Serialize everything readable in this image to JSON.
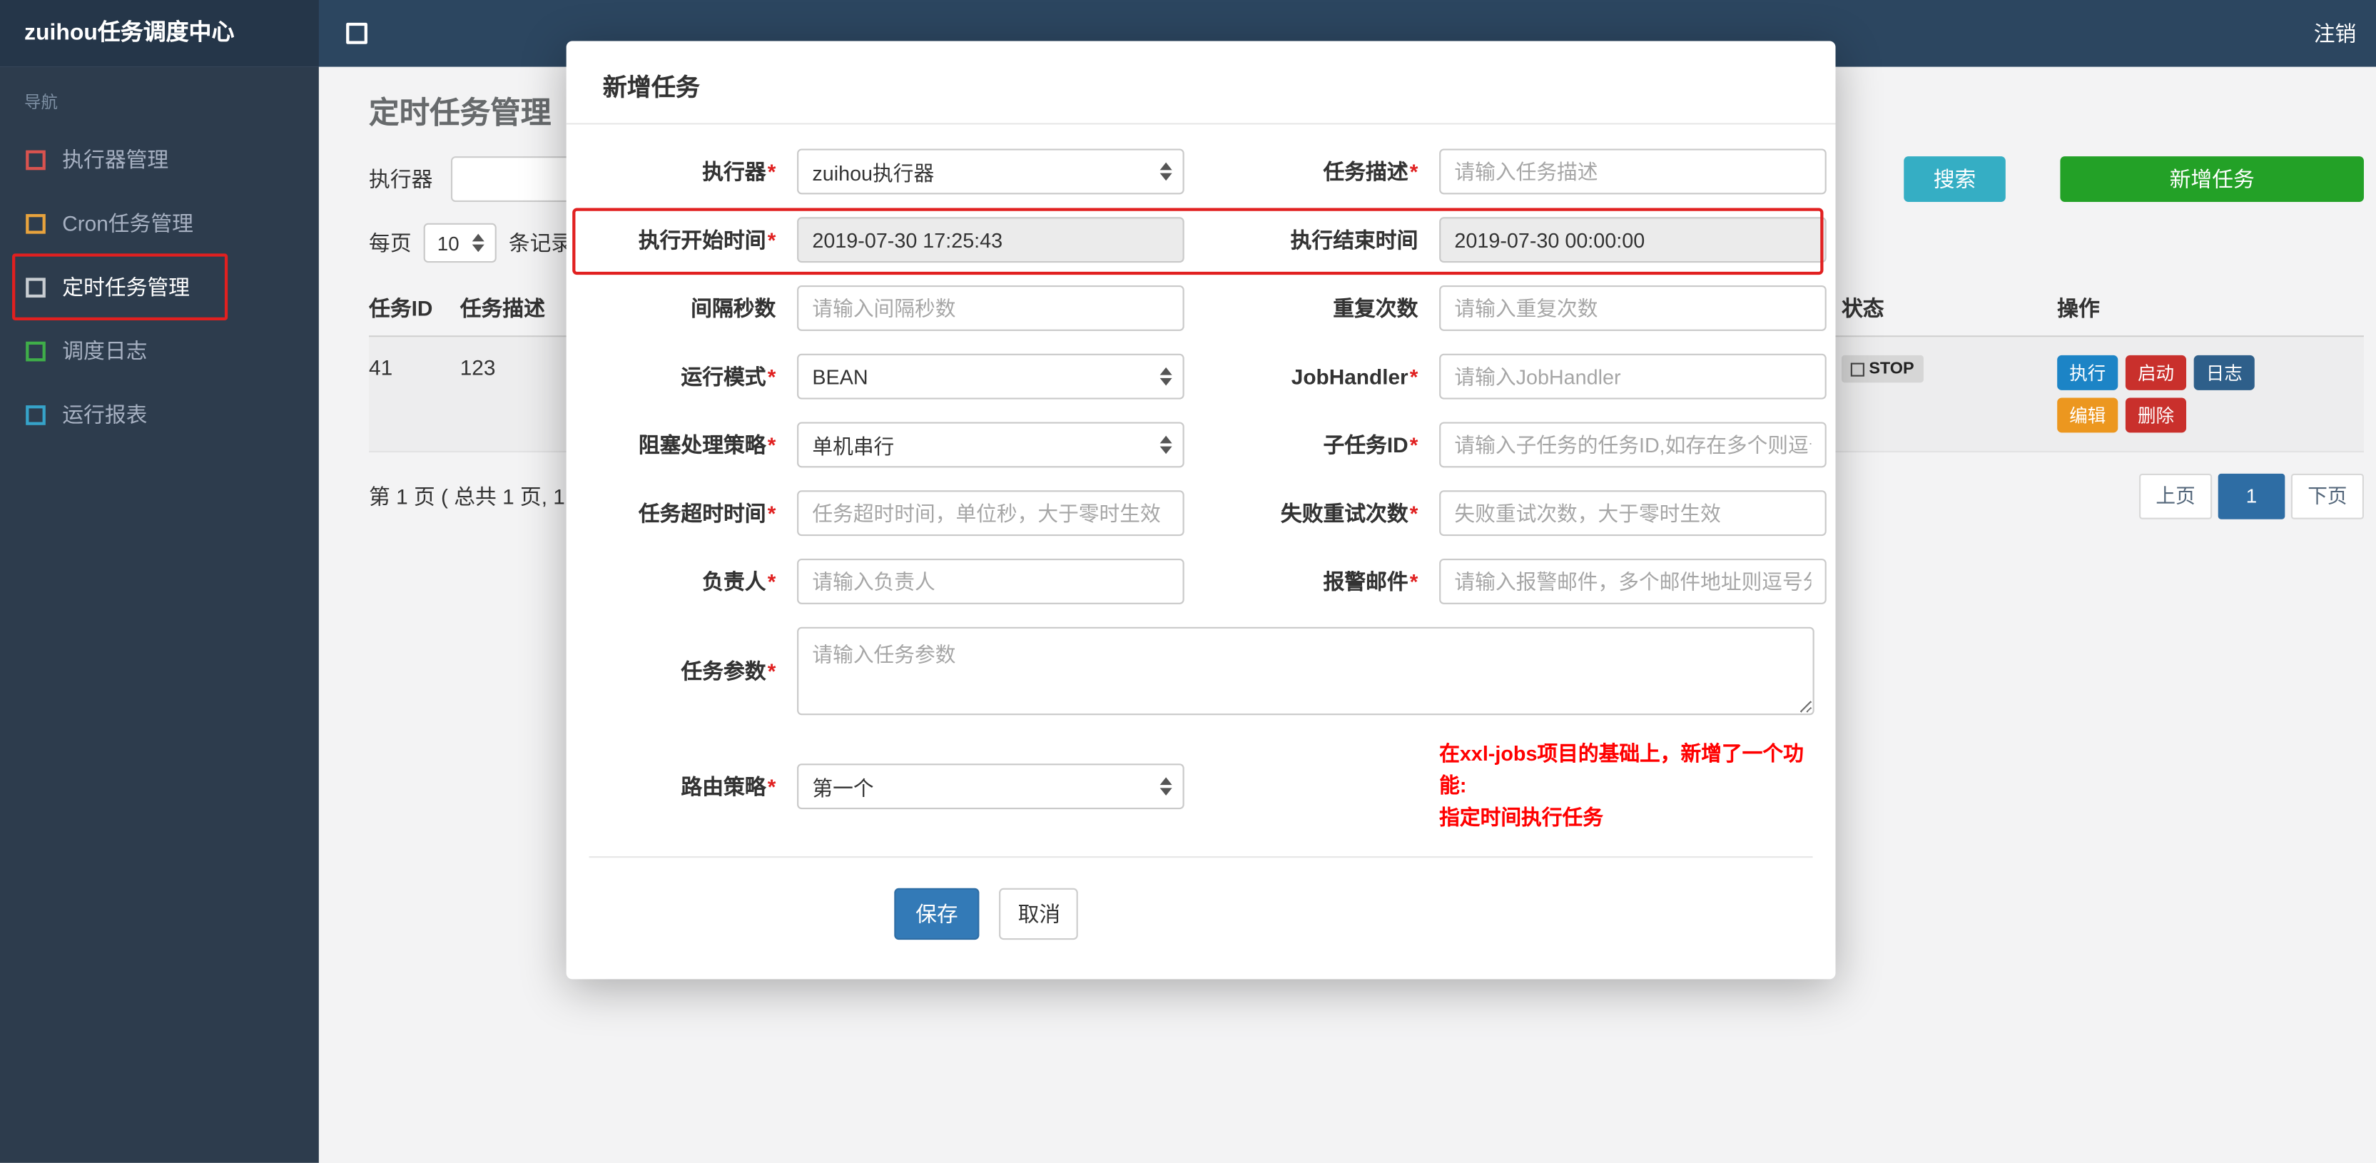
{
  "colors": {
    "topbar": "#2c4660",
    "brand_bg": "#253649",
    "sidebar_bg": "#2d3c4d",
    "search_button": "#35aec4",
    "add_button": "#23a127",
    "save_button": "#337ab7",
    "annotation_red": "#e12020"
  },
  "topbar": {
    "brand": "zuihou任务调度中心",
    "logout": "注销"
  },
  "sidebar": {
    "nav_label": "导航",
    "items": [
      {
        "label": "执行器管理",
        "icon_color": "#d9534f"
      },
      {
        "label": "Cron任务管理",
        "icon_color": "#e8a33d"
      },
      {
        "label": "定时任务管理",
        "icon_color": "#c8cdd2"
      },
      {
        "label": "调度日志",
        "icon_color": "#3fae49"
      },
      {
        "label": "运行报表",
        "icon_color": "#36a3c9"
      }
    ]
  },
  "page": {
    "title": "定时任务管理",
    "toolbar": {
      "executor_label": "执行器",
      "search": "搜索",
      "add": "新增任务"
    },
    "per_page": {
      "label": "每页",
      "value": "10",
      "suffix": "条记录"
    },
    "table": {
      "headers": [
        "任务ID",
        "任务描述",
        "状态",
        "操作"
      ],
      "rows": [
        {
          "job_id": "41",
          "job_desc": "123",
          "status": "STOP",
          "actions": [
            {
              "label": "执行",
              "color": "#1c84c6"
            },
            {
              "label": "启动",
              "color": "#c9302c"
            },
            {
              "label": "日志",
              "color": "#2e5f8a"
            },
            {
              "label": "编辑",
              "color": "#ec971f"
            },
            {
              "label": "删除",
              "color": "#c9302c"
            }
          ]
        }
      ]
    },
    "pagination": {
      "summary": "第 1 页 ( 总共 1 页, 1",
      "prev": "上页",
      "current": "1",
      "next": "下页"
    }
  },
  "modal": {
    "title": "新增任务",
    "required_mark": "*",
    "fields": {
      "executor": {
        "label": "执行器",
        "value": "zuihou执行器"
      },
      "job_desc": {
        "label": "任务描述",
        "placeholder": "请输入任务描述"
      },
      "start_time": {
        "label": "执行开始时间",
        "value": "2019-07-30 17:25:43"
      },
      "end_time": {
        "label": "执行结束时间",
        "value": "2019-07-30 00:00:00"
      },
      "interval": {
        "label": "间隔秒数",
        "placeholder": "请输入间隔秒数"
      },
      "repeat": {
        "label": "重复次数",
        "placeholder": "请输入重复次数"
      },
      "run_mode": {
        "label": "运行模式",
        "value": "BEAN"
      },
      "job_handler": {
        "label": "JobHandler",
        "placeholder": "请输入JobHandler"
      },
      "block_strategy": {
        "label": "阻塞处理策略",
        "value": "单机串行"
      },
      "child_job_id": {
        "label": "子任务ID",
        "placeholder": "请输入子任务的任务ID,如存在多个则逗号分隔"
      },
      "timeout": {
        "label": "任务超时时间",
        "placeholder": "任务超时时间，单位秒，大于零时生效"
      },
      "retry_count": {
        "label": "失败重试次数",
        "placeholder": "失败重试次数，大于零时生效"
      },
      "owner": {
        "label": "负责人",
        "placeholder": "请输入负责人"
      },
      "alarm_email": {
        "label": "报警邮件",
        "placeholder": "请输入报警邮件，多个邮件地址则逗号分隔"
      },
      "job_param": {
        "label": "任务参数",
        "placeholder": "请输入任务参数"
      },
      "route_strategy": {
        "label": "路由策略",
        "value": "第一个"
      }
    },
    "note_line1": "在xxl-jobs项目的基础上，新增了一个功能:",
    "note_line2": "指定时间执行任务",
    "save": "保存",
    "cancel": "取消"
  }
}
